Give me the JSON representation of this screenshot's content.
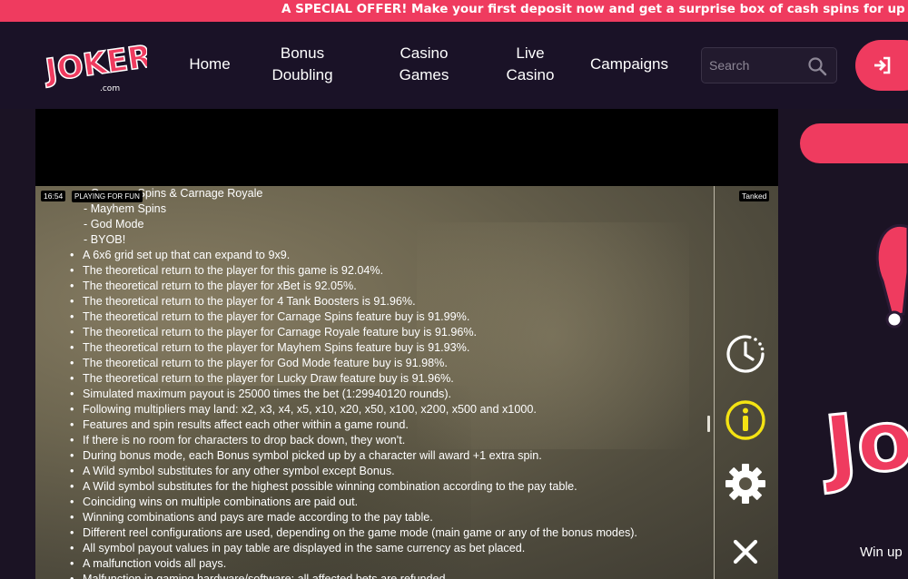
{
  "promo": {
    "text": "A SPECIAL OFFER! Make your first deposit now and get a surprise box of cash spins for up to ten games!"
  },
  "header": {
    "logo_text": "JOKERI",
    "logo_sub": ".com",
    "nav": [
      {
        "label_1": "Home",
        "label_2": ""
      },
      {
        "label_1": "Bonus",
        "label_2": "Doubling"
      },
      {
        "label_1": "Casino",
        "label_2": "Games"
      },
      {
        "label_1": "Live",
        "label_2": "Casino"
      },
      {
        "label_1": "Campaigns",
        "label_2": ""
      }
    ],
    "search_placeholder": "Search"
  },
  "side": {
    "logo_letters": "Jo",
    "text": "Win up"
  },
  "game": {
    "clock": "16:54",
    "mode_badge": "PLAYING FOR FUN",
    "game_badge": "Tanked",
    "rules_top": [
      "- Carnage Spins & Carnage Royale",
      "- Mayhem Spins",
      "- God Mode",
      "- BYOB!"
    ],
    "rules": [
      "A 6x6 grid set up that can expand to 9x9.",
      "The theoretical return to the player for this game is 92.04%.",
      "The theoretical return to the player for xBet is 92.05%.",
      "The theoretical return to the player for 4 Tank Boosters is 91.96%.",
      "The theoretical return to the player for Carnage Spins feature buy is 91.99%.",
      "The theoretical return to the player for Carnage Royale feature buy is 91.96%.",
      "The theoretical return to the player for Mayhem Spins feature buy is 91.93%.",
      "The theoretical return to the player for God Mode feature buy is 91.98%.",
      "The theoretical return to the player for Lucky Draw feature buy is 91.96%.",
      "Simulated maximum payout is 25000 times the bet (1:29940120 rounds).",
      "Following multipliers may land: x2, x3, x4, x5, x10, x20, x50, x100, x200, x500 and x1000.",
      "Features and spin results affect each other within a game round.",
      "If there is no room for characters to drop back down, they won't.",
      "During bonus mode, each Bonus symbol picked up by a character will award +1 extra spin.",
      "A Wild symbol substitutes for any other symbol except Bonus.",
      "A Wild symbol substitutes for the highest possible winning combination according to the pay table.",
      "Coinciding wins on multiple combinations are paid out.",
      "Winning combinations and pays are made according to the pay table.",
      "Different reel configurations are used, depending on the game mode (main game or any of the bonus modes).",
      "All symbol payout values in pay table are displayed in the same currency as bet placed.",
      "A malfunction voids all pays.",
      "Malfunction in gaming hardware/software: all affected bets are refunded."
    ]
  },
  "colors": {
    "accent": "#ef3b5f",
    "header_bg": "#1a1227",
    "info_yellow": "#f4e313"
  },
  "icons": [
    "user-login-icon",
    "search-icon",
    "history-clock-icon",
    "info-icon",
    "settings-gear-icon",
    "close-icon"
  ]
}
